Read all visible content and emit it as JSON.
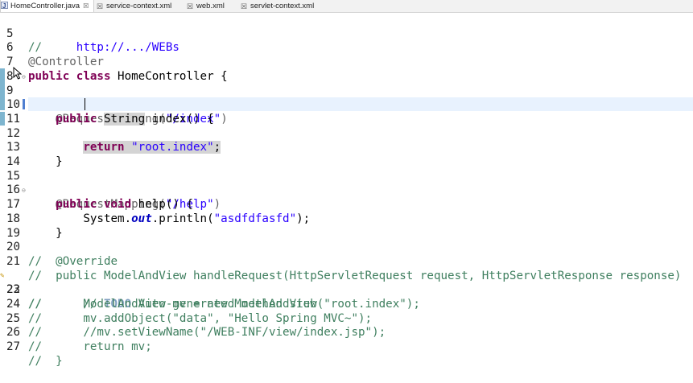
{
  "tabs": [
    {
      "label": "HomeController.java",
      "close": "☒",
      "active": true,
      "icon": "java-file-icon"
    },
    {
      "label": "service-context.xml",
      "close": "",
      "active": false,
      "icon": "xml-file-icon"
    },
    {
      "label": "web.xml",
      "close": "",
      "active": false,
      "icon": "xml-file-icon"
    },
    {
      "label": "servlet-context.xml",
      "close": "",
      "active": false,
      "icon": "xml-file-icon"
    }
  ],
  "lines": {
    "l5": {
      "num": "5",
      "a": "//",
      "b": "     http://.../WEBs"
    },
    "l6": {
      "num": "6",
      "a": "@Controller"
    },
    "l7": {
      "num": "7",
      "a": "public",
      "b": " ",
      "c": "class",
      "d": " HomeController {"
    },
    "l8": {
      "num": "8"
    },
    "l9": {
      "num": "9",
      "a": "    @RequestMapping(",
      "b": "\"/index\"",
      "c": ")"
    },
    "l10": {
      "num": "10",
      "a": "public",
      "b": " ",
      "c": "String",
      "d": " index() {"
    },
    "l11": {
      "num": "11"
    },
    "l12": {
      "num": "12",
      "a": "return",
      "b": " ",
      "c": "\"root.index\"",
      "d": ";"
    },
    "l13": {
      "num": "13",
      "a": "    }"
    },
    "l14": {
      "num": "14"
    },
    "l15": {
      "num": "15",
      "a": "    @RequestMapping(",
      "b": "\"/help\"",
      "c": ")"
    },
    "l16": {
      "num": "16",
      "a": "public",
      "b": " ",
      "c": "void",
      "d": " help() {"
    },
    "l17": {
      "num": "17",
      "a": "        System.",
      "b": "out",
      "c": ".println(",
      "d": "\"asdfdfasfd\"",
      "e": ");"
    },
    "l18": {
      "num": "18",
      "a": "    }"
    },
    "l19": {
      "num": "19"
    },
    "l20": {
      "num": "20",
      "a": "//  @Override"
    },
    "l21": {
      "num": "21",
      "a": "//  public ModelAndView handleRequest(HttpServletRequest request, HttpServletResponse response)"
    },
    "l22": {
      "num": "22",
      "a": "//      // ",
      "b": "TODO",
      "c": " Auto-generated method stub"
    },
    "l23": {
      "num": "23",
      "a": "//      ModelAndView mv = new ModelAndView(\"root.index\");"
    },
    "l24": {
      "num": "24",
      "a": "//      mv.addObject(\"data\", \"Hello Spring MVC~\");"
    },
    "l25": {
      "num": "25",
      "a": "//      //mv.setViewName(\"/WEB-INF/view/index.jsp\");"
    },
    "l26": {
      "num": "26",
      "a": "//      return mv;"
    },
    "l27": {
      "num": "27",
      "a": "//  }"
    }
  },
  "colors": {
    "keyword": "#7f0055",
    "comment": "#3f7f5f",
    "string": "#2a00ff",
    "annotation": "#646464",
    "current_line": "#e8f2fe",
    "selection": "#d4d4d4"
  }
}
